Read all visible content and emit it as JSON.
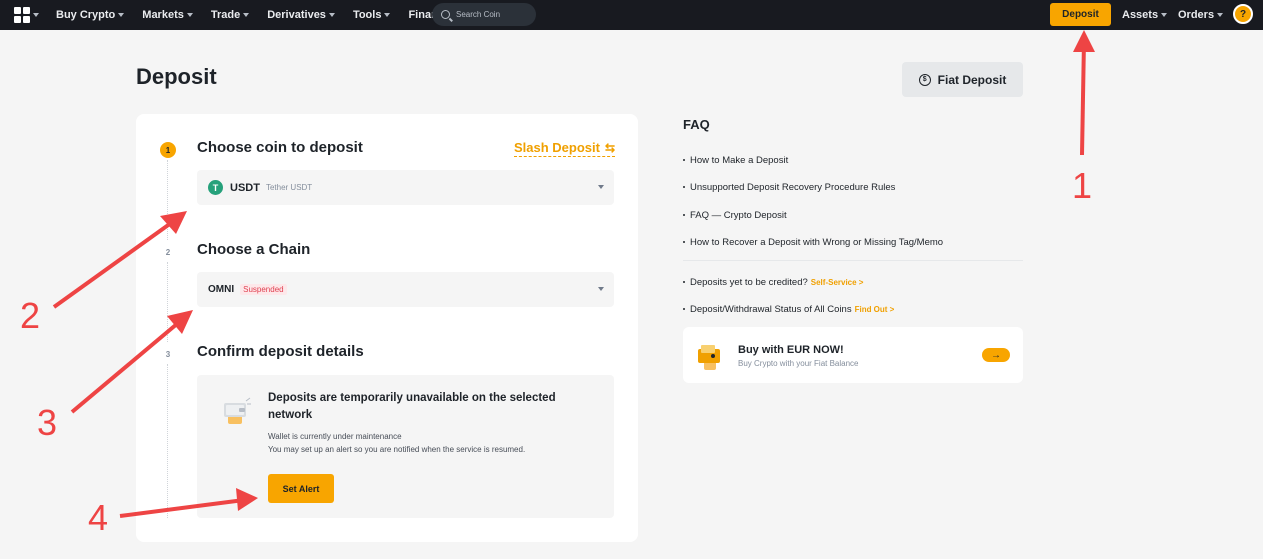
{
  "nav": {
    "items": [
      {
        "label": "Buy Crypto"
      },
      {
        "label": "Markets"
      },
      {
        "label": "Trade"
      },
      {
        "label": "Derivatives"
      },
      {
        "label": "Tools"
      },
      {
        "label": "Finance"
      }
    ],
    "search_placeholder": "Search Coin",
    "deposit_label": "Deposit",
    "assets_label": "Assets",
    "orders_label": "Orders"
  },
  "page": {
    "title": "Deposit",
    "fiat_deposit_label": "Fiat Deposit"
  },
  "steps": [
    {
      "number": "1",
      "title": "Choose coin to deposit"
    },
    {
      "number": "2",
      "title": "Choose a Chain"
    },
    {
      "number": "3",
      "title": "Confirm deposit details"
    }
  ],
  "slash_deposit_label": "Slash Deposit",
  "coin": {
    "icon_letter": "T",
    "symbol": "USDT",
    "name": "Tether USDT",
    "icon_color": "#26a17b"
  },
  "chain": {
    "symbol": "OMNI",
    "status": "Suspended"
  },
  "notice": {
    "title": "Deposits are temporarily unavailable on the selected network",
    "line1": "Wallet is currently under maintenance",
    "line2": "You may set up an alert so you are notified when the service is resumed.",
    "button_label": "Set Alert"
  },
  "faq": {
    "title": "FAQ",
    "items": [
      "How to Make a Deposit",
      "Unsupported Deposit Recovery Procedure Rules",
      "FAQ — Crypto Deposit",
      "How to Recover a Deposit with Wrong or Missing Tag/Memo"
    ],
    "extra": [
      {
        "text": "Deposits yet to be credited?",
        "link": "Self-Service >"
      },
      {
        "text": "Deposit/Withdrawal Status of All Coins",
        "link": "Find Out >"
      }
    ]
  },
  "buy_card": {
    "title": "Buy with EUR NOW!",
    "subtitle": "Buy Crypto with your Fiat Balance"
  },
  "annotations": [
    "1",
    "2",
    "3",
    "4"
  ],
  "colors": {
    "accent": "#f8a500",
    "nav_bg": "#181a20",
    "arrow": "#ee4444",
    "suspended": "#e04050"
  }
}
